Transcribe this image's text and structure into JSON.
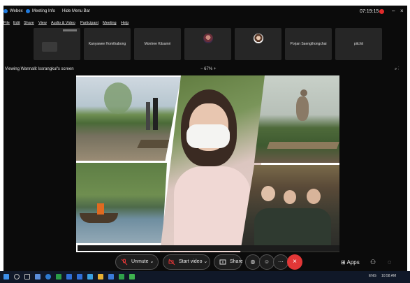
{
  "titlebar": {
    "app": "Webex",
    "meeting_info": "Meeting Info",
    "hide_menu": "Hide Menu Bar",
    "timer": "07:19:15"
  },
  "menu": [
    "File",
    "Edit",
    "Share",
    "View",
    "Audio & Video",
    "Participant",
    "Meeting",
    "Help"
  ],
  "participants": [
    {
      "name": "",
      "type": "camera"
    },
    {
      "name": "Kanyawee Homthabong",
      "type": "name"
    },
    {
      "name": "Montree Kitsamri",
      "type": "name"
    },
    {
      "name": "",
      "type": "avatar"
    },
    {
      "name": "",
      "type": "avatar"
    },
    {
      "name": "Porjan Saengthongchai",
      "type": "name"
    },
    {
      "name": "pitchit",
      "type": "name"
    }
  ],
  "share": {
    "viewing": "Viewing Wannalit Issrangkul's screen",
    "zoom": "67%"
  },
  "controls": {
    "unmute": "Unmute",
    "start_video": "Start video",
    "share": "Share",
    "apps": "Apps"
  },
  "taskbar": {
    "lang": "ENG",
    "time": "10:58 AM"
  },
  "colors": {
    "accent": "#1f7be0",
    "leave": "#e23737",
    "mute_red": "#e23737"
  }
}
